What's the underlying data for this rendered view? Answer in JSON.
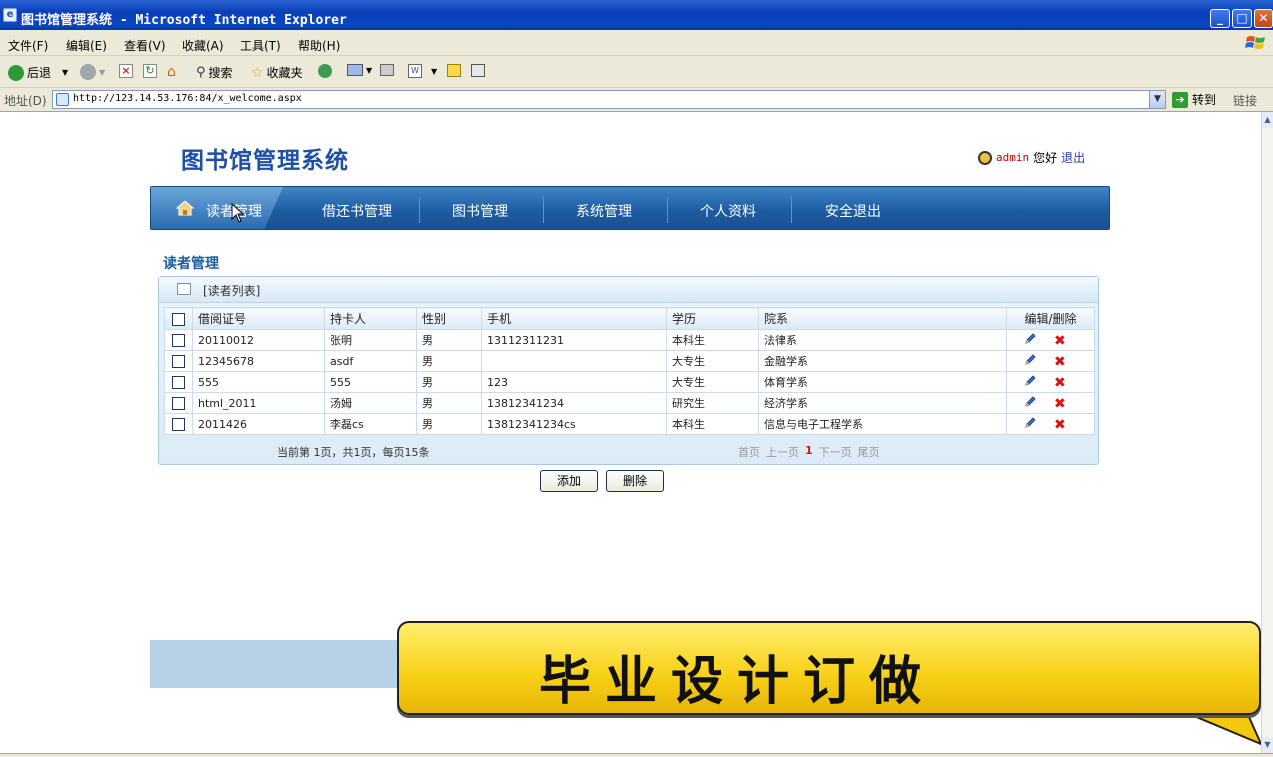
{
  "window": {
    "title": "图书馆管理系统 - Microsoft Internet Explorer",
    "min": "_",
    "max": "□",
    "close": "✕"
  },
  "menu": [
    "文件(F)",
    "编辑(E)",
    "查看(V)",
    "收藏(A)",
    "工具(T)",
    "帮助(H)"
  ],
  "toolbar": {
    "back": "后退",
    "search": "搜索",
    "favorites": "收藏夹"
  },
  "address": {
    "label": "地址(D)",
    "url": "http://123.14.53.176:84/x_welcome.aspx",
    "go": "转到",
    "links": "链接"
  },
  "page": {
    "logo": "图书馆管理系统",
    "user": "admin",
    "greeting": "您好",
    "logout": "退出",
    "nav": [
      "读者管理",
      "借还书管理",
      "图书管理",
      "系统管理",
      "个人资料",
      "安全退出"
    ],
    "section_title": "读者管理",
    "list_title": "[读者列表]",
    "columns": [
      "借阅证号",
      "持卡人",
      "性别",
      "手机",
      "学历",
      "院系",
      "编辑/删除"
    ],
    "rows": [
      [
        "20110012",
        "张明",
        "男",
        "13112311231",
        "本科生",
        "法律系"
      ],
      [
        "12345678",
        "asdf",
        "男",
        "",
        "大专生",
        "金融学系"
      ],
      [
        "555",
        "555",
        "男",
        "123",
        "大专生",
        "体育学系"
      ],
      [
        "html_2011",
        "汤姆",
        "男",
        "13812341234",
        "研究生",
        "经济学系"
      ],
      [
        "2011426",
        "李磊cs",
        "男",
        "13812341234cs",
        "本科生",
        "信息与电子工程学系"
      ]
    ],
    "pager_info": "当前第 1页，共1页，每页15条",
    "pager": {
      "first": "首页",
      "prev": "上一页",
      "current": "1",
      "next": "下一页",
      "last": "尾页"
    },
    "add_button": "添加",
    "delete_button": "删除",
    "banner_text": "毕业设计订做"
  },
  "colors": {
    "nav_blue": "#1e5da2",
    "banner_yellow": "#f7cf15",
    "delete_red": "#dd1111"
  }
}
